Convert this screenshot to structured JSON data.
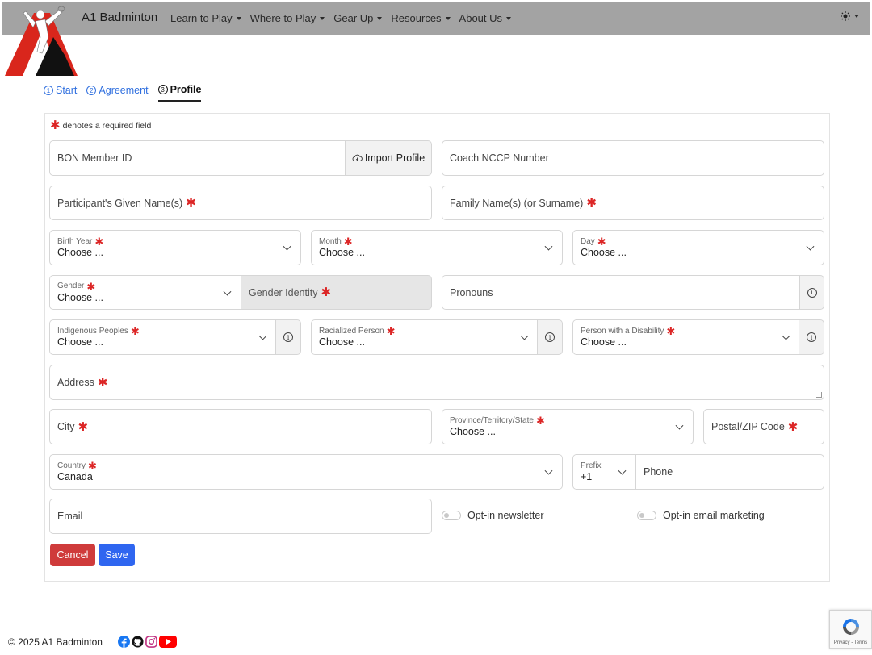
{
  "brand": "A1 Badminton",
  "nav": [
    "Learn to Play",
    "Where to Play",
    "Gear Up",
    "Resources",
    "About Us"
  ],
  "theme_icon": "sun-icon",
  "steps": [
    {
      "num": "1",
      "label": "Start"
    },
    {
      "num": "2",
      "label": "Agreement"
    },
    {
      "num": "3",
      "label": "Profile"
    }
  ],
  "required_note": "denotes a required field",
  "form": {
    "member_id": "BON Member ID",
    "import_profile": "Import Profile",
    "coach_nccp": "Coach NCCP Number",
    "given_name": "Participant's Given Name(s)",
    "family_name": "Family Name(s) (or Surname)",
    "birth_year": {
      "label": "Birth Year",
      "value": "Choose ..."
    },
    "month": {
      "label": "Month",
      "value": "Choose ..."
    },
    "day": {
      "label": "Day",
      "value": "Choose ..."
    },
    "gender": {
      "label": "Gender",
      "value": "Choose ..."
    },
    "gender_identity": "Gender Identity",
    "pronouns": "Pronouns",
    "indigenous": {
      "label": "Indigenous Peoples",
      "value": "Choose ..."
    },
    "racialized": {
      "label": "Racialized Person",
      "value": "Choose ..."
    },
    "disability": {
      "label": "Person with a Disability",
      "value": "Choose ..."
    },
    "address": "Address",
    "city": "City",
    "province": {
      "label": "Province/Territory/State",
      "value": "Choose ..."
    },
    "postal": "Postal/ZIP Code",
    "country": {
      "label": "Country",
      "value": "Canada"
    },
    "prefix": {
      "label": "Prefix",
      "value": "+1"
    },
    "phone": "Phone",
    "email": "Email",
    "optin_newsletter": "Opt-in newsletter",
    "optin_marketing": "Opt-in email marketing",
    "cancel": "Cancel",
    "save": "Save"
  },
  "footer": "© 2025 A1 Badminton",
  "socials": [
    "facebook-icon",
    "github-icon",
    "instagram-icon",
    "youtube-icon"
  ],
  "recaptcha": "Privacy - Terms",
  "colors": {
    "required": "#dc2626",
    "cancel": "#cf3b3b",
    "save": "#2f66f0",
    "navbar": "#a3a3a3",
    "link": "#2f6fdf"
  }
}
